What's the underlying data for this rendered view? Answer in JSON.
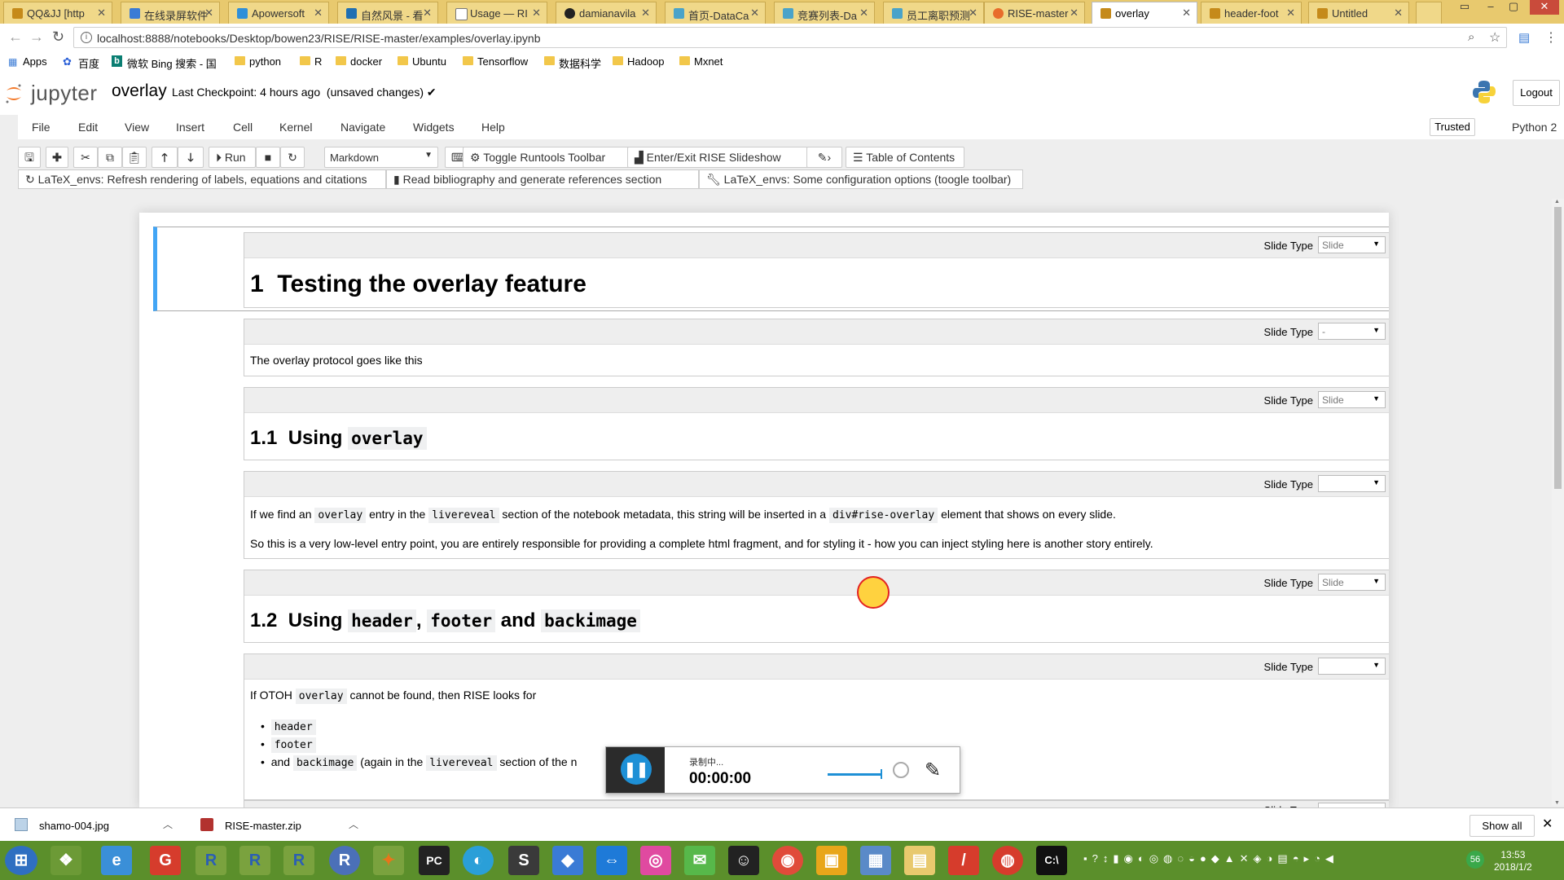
{
  "browser": {
    "tabs": [
      {
        "label": "QQ&JJ [http"
      },
      {
        "label": "在线录屏软件"
      },
      {
        "label": "Apowersoft"
      },
      {
        "label": "自然风景 - 看"
      },
      {
        "label": "Usage — RI"
      },
      {
        "label": "damianavila"
      },
      {
        "label": "首页-DataCa"
      },
      {
        "label": "竞赛列表-Da"
      },
      {
        "label": "员工离职预测"
      },
      {
        "label": "RISE-master"
      },
      {
        "label": "overlay"
      },
      {
        "label": "header-foot"
      },
      {
        "label": "Untitled"
      }
    ],
    "active_tab": "overlay",
    "url": "localhost:8888/notebooks/Desktop/bowen23/RISE/RISE-master/examples/overlay.ipynb",
    "bookmarks": [
      "Apps",
      "百度",
      "微软 Bing 搜索 - 国",
      "python",
      "R",
      "docker",
      "Ubuntu",
      "Tensorflow",
      "数据科学",
      "Hadoop",
      "Mxnet"
    ]
  },
  "jupyter": {
    "logo_text": "jupyter",
    "notebook_name": "overlay",
    "checkpoint": "Last Checkpoint: 4 hours ago",
    "unsaved": "(unsaved changes)",
    "logout": "Logout",
    "menus": [
      "File",
      "Edit",
      "View",
      "Insert",
      "Cell",
      "Kernel",
      "Navigate",
      "Widgets",
      "Help"
    ],
    "trusted": "Trusted",
    "kernel": "Python 2",
    "cell_type": "Markdown",
    "toolbar": {
      "run": "Run",
      "toggle_runtools": "Toggle Runtools Toolbar",
      "rise": "Enter/Exit RISE Slideshow",
      "toc": "Table of Contents"
    },
    "toolbar2": {
      "latex_refresh": "LaTeX_envs: Refresh rendering of labels, equations and citations",
      "bibliography": "Read bibliography and generate references section",
      "latex_config": "LaTeX_envs: Some configuration options (toogle toolbar)"
    }
  },
  "cells": {
    "slide_type_label": "Slide Type",
    "c1": {
      "slide_type": "Slide",
      "num": "1",
      "title": "Testing the overlay feature"
    },
    "c2": {
      "slide_type": "-",
      "text": "The overlay protocol goes like this"
    },
    "c3": {
      "slide_type": "Slide",
      "num": "1.1",
      "title_pre": "Using",
      "code": "overlay"
    },
    "c4": {
      "slide_type": "",
      "p1": [
        "If we find an",
        "overlay",
        "entry in the",
        "livereveal",
        "section of the notebook metadata, this string will be inserted in a",
        "div#rise-overlay",
        "element that shows on every slide."
      ],
      "p2": "So this is a very low-level entry point, you are entirely responsible for providing a complete html fragment, and for styling it - how you can inject styling here is another story entirely."
    },
    "c5": {
      "slide_type": "Slide",
      "num": "1.2",
      "title_pre": "Using",
      "code1": "header",
      "sep": ",",
      "code2": "footer",
      "and": "and",
      "code3": "backimage"
    },
    "c6": {
      "slide_type": "",
      "p1": [
        "If OTOH",
        "overlay",
        "cannot be found, then RISE looks for"
      ],
      "items": [
        "header",
        "footer"
      ],
      "item3": [
        "and",
        "backimage",
        "(again in the",
        "livereveal",
        "section of the n"
      ]
    },
    "c7": {
      "slide_type": "Slide"
    }
  },
  "recorder": {
    "status": "录制中...",
    "time": "00:00:00"
  },
  "downloads": {
    "files": [
      "shamo-004.jpg",
      "RISE-master.zip"
    ],
    "show_all": "Show all"
  },
  "clock": {
    "time": "13:53",
    "date": "2018/1/2"
  },
  "colors": {
    "selected_cell_bar": "#42a5f5",
    "taskbar": "#5b8f2b",
    "tabbar": "#e8c96e"
  }
}
